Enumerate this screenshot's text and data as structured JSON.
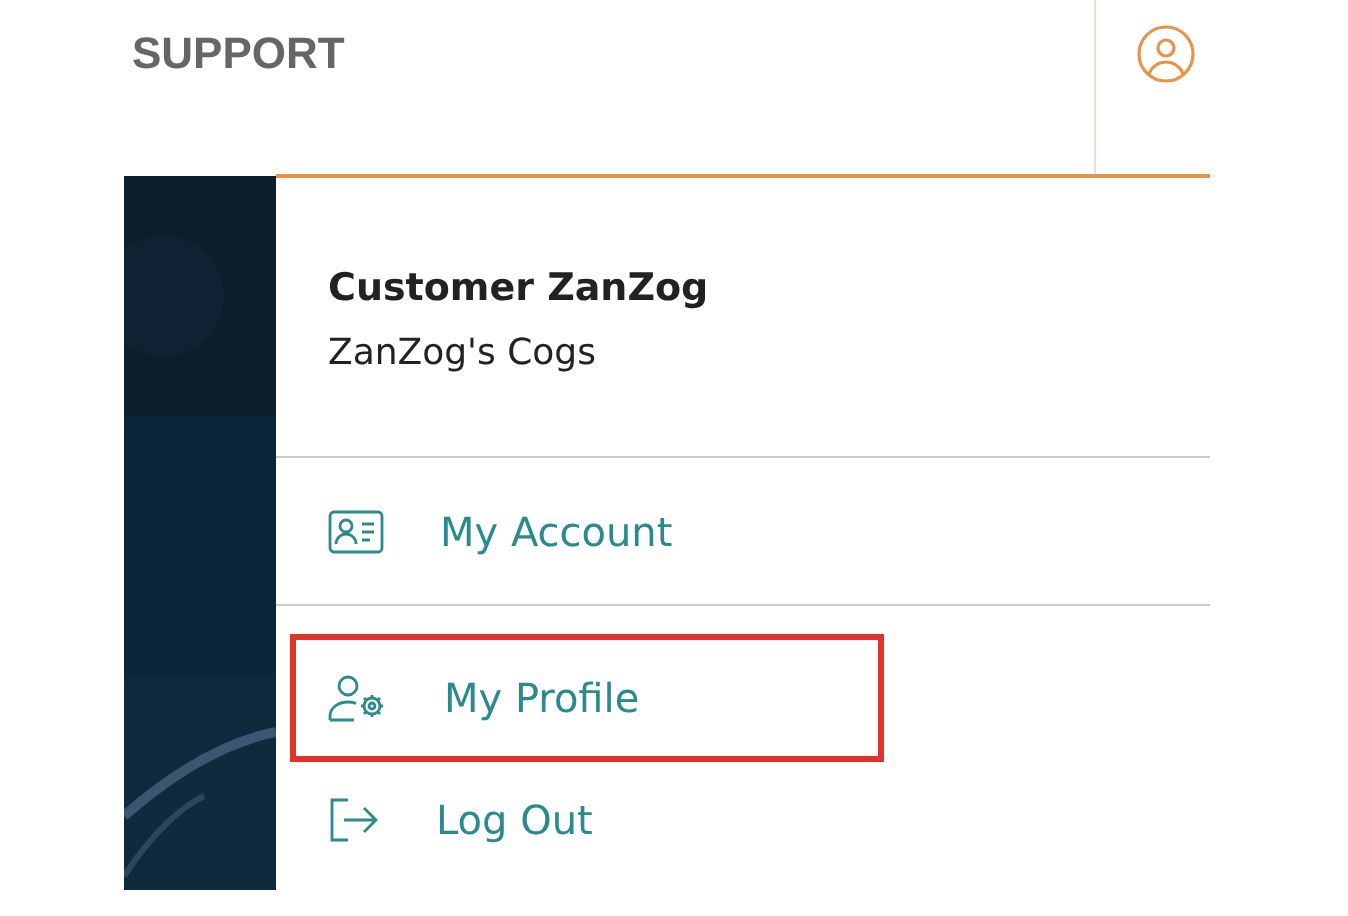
{
  "header": {
    "title": "SUPPORT"
  },
  "user": {
    "name": "Customer ZanZog",
    "company": "ZanZog's Cogs"
  },
  "menu": [
    {
      "label": "My Account",
      "kind": "account",
      "highlighted": false
    },
    {
      "label": "My Profile",
      "kind": "profile",
      "highlighted": true
    },
    {
      "label": "Log Out",
      "kind": "logout",
      "highlighted": false
    }
  ]
}
